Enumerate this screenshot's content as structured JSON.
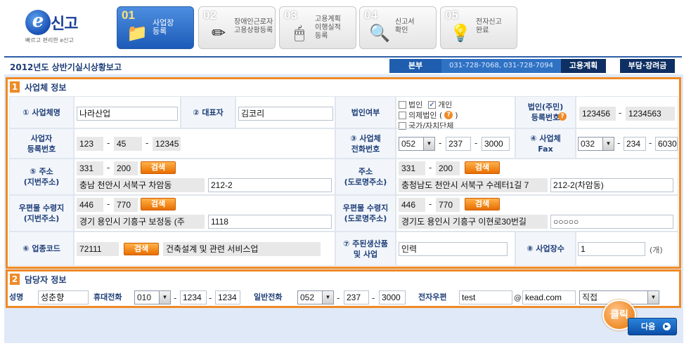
{
  "logo": {
    "text": "신고",
    "mark": "e",
    "sub": "빠르고 편리한 e신고"
  },
  "steps": [
    {
      "num": "01",
      "label": "사업장\n등록",
      "icon": "📁"
    },
    {
      "num": "02",
      "label": "장애인근로자\n고용상황등록",
      "icon": "✏"
    },
    {
      "num": "03",
      "label": "고용계획\n이행실적\n등록",
      "icon": "🖱"
    },
    {
      "num": "04",
      "label": "신고서\n확인",
      "icon": "🔍"
    },
    {
      "num": "05",
      "label": "전자신고\n완료",
      "icon": "💡"
    }
  ],
  "topbar": {
    "title": "2012년도 상반기실시상황보고",
    "dept": "본부",
    "phone": "031-728-7068, 031-728-7094",
    "plan": "고용계획",
    "burden": "부담·장려금"
  },
  "section1": {
    "num": "1",
    "title": "사업체 정보",
    "company_name_label": "① 사업체명",
    "company_name": "나라산업",
    "ceo_label": "② 대표자",
    "ceo": "김코리",
    "corp_label": "법인여부",
    "corp_options": {
      "corp": "법인",
      "individual": "개인",
      "deemed": "의제법인 (",
      "deemed_end": ")",
      "gov": "국가/자치단체"
    },
    "corp_reg_label": "법인(주민)\n등록번호",
    "corp_reg_1": "123456",
    "corp_reg_2": "1234563",
    "biz_reg_label": "사업자\n등록번호",
    "biz_reg_1": "123",
    "biz_reg_2": "45",
    "biz_reg_3": "12345",
    "phone_label": "③ 사업체\n전화번호",
    "phone_1": "052",
    "phone_2": "237",
    "phone_3": "3000",
    "fax_label": "④ 사업체\nFax",
    "fax_1": "032",
    "fax_2": "234",
    "fax_3": "6030",
    "addr_jibun_label": "⑤ 주소\n(지번주소)",
    "addr_jibun_zip1": "331",
    "addr_jibun_zip2": "200",
    "addr_jibun_main": "충남 천안시 서북구 차암동",
    "addr_jibun_detail": "212-2",
    "addr_road_label": "주소\n(도로명주소)",
    "addr_road_zip1": "331",
    "addr_road_zip2": "200",
    "addr_road_main": "충청남도 천안시 서북구 수레터1길 7",
    "addr_road_detail": "212-2(차암동)",
    "mail_jibun_label": "우편물 수령지\n(지번주소)",
    "mail_jibun_zip1": "446",
    "mail_jibun_zip2": "770",
    "mail_jibun_main": "경기 용인시 기흥구 보정동 (주",
    "mail_jibun_detail": "1118",
    "mail_road_label": "우편물 수령지\n(도로명주소)",
    "mail_road_zip1": "446",
    "mail_road_zip2": "770",
    "mail_road_main": "경기도 용인시 기흥구 이현로30번길",
    "mail_road_detail": "○○○○○",
    "industry_label": "⑥ 업종코드",
    "industry_code": "72111",
    "industry_name": "건축설계 및 관련 서비스업",
    "product_label": "⑦ 주된생산품\n및 사업",
    "product": "인력",
    "sites_label": "⑧ 사업장수",
    "sites": "1",
    "sites_unit": "(개)",
    "search_label": "검색",
    "dash": "-"
  },
  "section2": {
    "num": "2",
    "title": "담당자 정보",
    "name_label": "성명",
    "name": "성춘향",
    "mobile_label": "휴대전화",
    "mobile_1": "010",
    "mobile_2": "1234",
    "mobile_3": "1234",
    "tel_label": "일반전화",
    "tel_1": "052",
    "tel_2": "237",
    "tel_3": "3000",
    "email_label": "전자우편",
    "email_id": "test",
    "email_at": "@",
    "email_domain": "kead.com",
    "email_select": "직접"
  },
  "click_bubble": "클릭",
  "next_button": "다음"
}
